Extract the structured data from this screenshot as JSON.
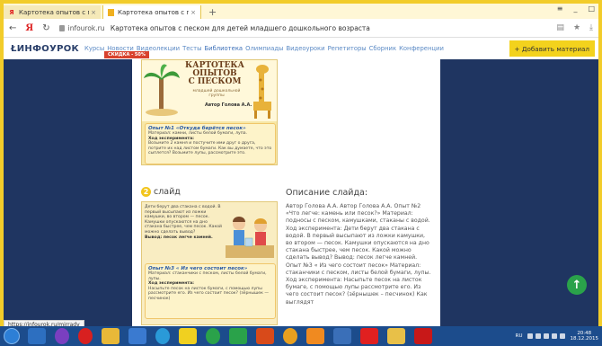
{
  "browser": {
    "tabs": [
      {
        "title": "Картотека опытов с песко",
        "active": false
      },
      {
        "title": "Картотека опытов с пес",
        "active": true
      }
    ],
    "new_tab": "+",
    "url_host": "infourok.ru",
    "url_title": "Картотека опытов с песком для детей младшего дошкольного возраста",
    "window_controls": {
      "menu": "≡",
      "minimize": "_",
      "maximize": "□"
    }
  },
  "site": {
    "logo": "ИНФОУРОК",
    "promo_badge": "СКИДКА - 50%",
    "nav": [
      "Курсы",
      "Новости",
      "Видеолекции",
      "Тесты",
      "Библиотека",
      "Олимпиады",
      "Видеоуроки",
      "Репетиторы",
      "Сборник",
      "Конференции"
    ],
    "add_material": "+ Добавить материал"
  },
  "slide1": {
    "title_lines": [
      "КАРТОТЕКА",
      "ОПЫТОВ",
      "С ПЕСКОМ"
    ],
    "subtitle": "младшей дошкольной группы",
    "author": "Автор Голова А.А.",
    "exp_title": "Опыт №1 «Откуда берётся песок»",
    "material": "Материал: камни, листы белой бумаги, лупа.",
    "progress_label": "Ход эксперимента:",
    "text": "Возьмите 2 камня и постучите ими друг о друга, потрите их над листом бумаги. Как вы думаете, что это сыплется? Возьмите лупы, рассмотрите это."
  },
  "slide2": {
    "number": "2",
    "label": "слайд",
    "p1": "Дети берут два стакана с водой. В первый высыпают из ложки камушки, во втором — песок. Камушки опускаются на дно стакана быстрее, чем песок. Какой можно сделать вывод?",
    "conclusion": "Вывод: песок легче камней.",
    "exp_title": "Опыт №3 « Из чего состоит песок»",
    "material": "Материал: стаканчики с песком, листы белой бумаги, лупы.",
    "progress_label": "Ход эксперимента:",
    "text": "Насыпьте песок на листок бумаги, с помощью лупы рассмотрите его. Из чего состоит песок? (зёрнышек — песчинок)"
  },
  "description": {
    "title": "Описание слайда:",
    "text": "Автор Голова А.А. Автор Голова А.А. Опыт №2 «Что легче: камень или песок?» Материал: подносы с песком, камушками, стаканы с водой. Ход эксперимента: Дети берут два стакана с водой. В первый высыпают из ложки камушки, во втором — песок. Камушки опускаются на дно стакана быстрее, чем песок. Какой можно сделать вывод? Вывод: песок легче камней. Опыт №3 « Из чего состоит песок» Материал: стаканчики с песком, листы белой бумаги, лупы. Ход эксперимента: Насыпьте песок на листок бумаге, с помощью лупы рассмотрите его. Из чего состоит песок? (зёрнышек – песчинок) Как выглядят"
  },
  "status_url": "https://infourok.ru/mirrady",
  "scroll_top": "↑",
  "taskbar": {
    "lang": "RU",
    "time": "20:48",
    "date": "18.12.2015"
  }
}
